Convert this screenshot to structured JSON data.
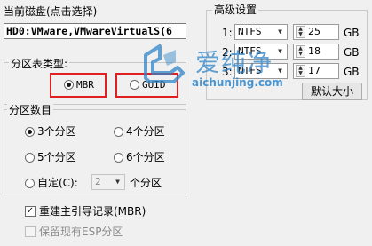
{
  "disk": {
    "section_label": "当前磁盘(点击选择)",
    "value": "HD0:VMware,VMwareVirtualS(6"
  },
  "partition_table": {
    "label": "分区表类型:",
    "options": [
      {
        "label": "MBR",
        "selected": true
      },
      {
        "label": "GUID",
        "selected": false
      }
    ]
  },
  "partition_count": {
    "label": "分区数目",
    "options": [
      {
        "label": "3个分区",
        "selected": true
      },
      {
        "label": "4个分区",
        "selected": false
      },
      {
        "label": "5个分区",
        "selected": false
      },
      {
        "label": "6个分区",
        "selected": false
      }
    ],
    "custom": {
      "label": "自定(C):",
      "value": "2",
      "suffix": "个分区",
      "enabled": false
    }
  },
  "options": {
    "rebuild_mbr": {
      "label": "重建主引导记录(MBR)",
      "checked": true
    },
    "keep_esp": {
      "label": "保留现有ESP分区",
      "checked": false,
      "enabled": false
    }
  },
  "advanced": {
    "label": "高级设置",
    "rows": [
      {
        "index": "1:",
        "fs": "NTFS",
        "size": "25",
        "unit": "GB"
      },
      {
        "index": "2:",
        "fs": "NTFS",
        "size": "18",
        "unit": "GB"
      },
      {
        "index": "3:",
        "fs": "NTFS",
        "size": "17",
        "unit": "GB"
      }
    ],
    "default_size_button": "默认大小"
  },
  "watermark": {
    "brand": "爱纯净",
    "url": "aichunjing.com",
    "color": "#2f84c9"
  },
  "colors": {
    "highlight": "#e02020",
    "background": "#f0f0f0"
  }
}
